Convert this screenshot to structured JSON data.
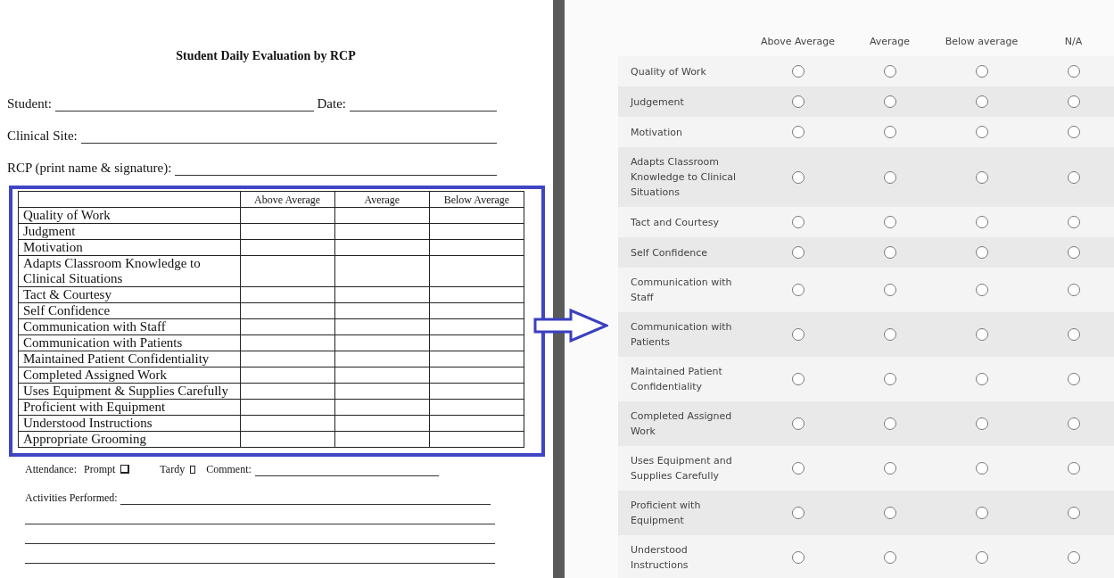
{
  "paper_form": {
    "title": "Student Daily Evaluation by RCP",
    "header_fields": [
      {
        "label": "Student:",
        "kind": "pair",
        "second_label": "Date:"
      },
      {
        "label": "Clinical Site:",
        "kind": "single"
      },
      {
        "label": "RCP (print name & signature):",
        "kind": "single"
      }
    ],
    "table": {
      "columns": [
        "Above Average",
        "Average",
        "Below Average"
      ],
      "rows": [
        "Quality of Work",
        "Judgment",
        "Motivation",
        "Adapts Classroom Knowledge to Clinical Situations",
        "Tact & Courtesy",
        "Self Confidence",
        "Communication with Staff",
        "Communication with Patients",
        "Maintained Patient Confidentiality",
        "Completed Assigned Work",
        "Uses Equipment & Supplies Carefully",
        "Proficient with Equipment",
        "Understood Instructions",
        "Appropriate Grooming"
      ]
    },
    "attendance": {
      "label": "Attendance:",
      "options": [
        {
          "label": "Prompt",
          "checked": false
        },
        {
          "label": "Tardy",
          "checked": false
        }
      ],
      "comment_label": "Comment:"
    },
    "activities_label": "Activities Performed:"
  },
  "online_form": {
    "columns": [
      "Above Average",
      "Average",
      "Below average",
      "N/A"
    ],
    "rows": [
      {
        "label": "Quality of Work",
        "choices": [
          false,
          false,
          false,
          false
        ]
      },
      {
        "label": "Judgement",
        "choices": [
          false,
          false,
          false,
          false
        ]
      },
      {
        "label": "Motivation",
        "choices": [
          false,
          false,
          false,
          false
        ]
      },
      {
        "label": "Adapts Classroom Knowledge to Clinical Situations",
        "choices": [
          false,
          false,
          false,
          false
        ]
      },
      {
        "label": "Tact and Courtesy",
        "choices": [
          false,
          false,
          false,
          false
        ]
      },
      {
        "label": "Self Confidence",
        "choices": [
          false,
          false,
          false,
          false
        ]
      },
      {
        "label": "Communication with Staff",
        "choices": [
          false,
          false,
          false,
          false
        ]
      },
      {
        "label": "Communication with Patients",
        "choices": [
          false,
          false,
          false,
          false
        ]
      },
      {
        "label": "Maintained Patient Confidentiality",
        "choices": [
          false,
          false,
          false,
          false
        ]
      },
      {
        "label": "Completed Assigned Work",
        "choices": [
          false,
          false,
          false,
          false
        ]
      },
      {
        "label": "Uses Equipment and Supplies Carefully",
        "choices": [
          false,
          false,
          false,
          false
        ]
      },
      {
        "label": "Proficient with Equipment",
        "choices": [
          false,
          false,
          false,
          false
        ]
      },
      {
        "label": "Understood Instructions",
        "choices": [
          false,
          false,
          false,
          false
        ]
      }
    ]
  }
}
